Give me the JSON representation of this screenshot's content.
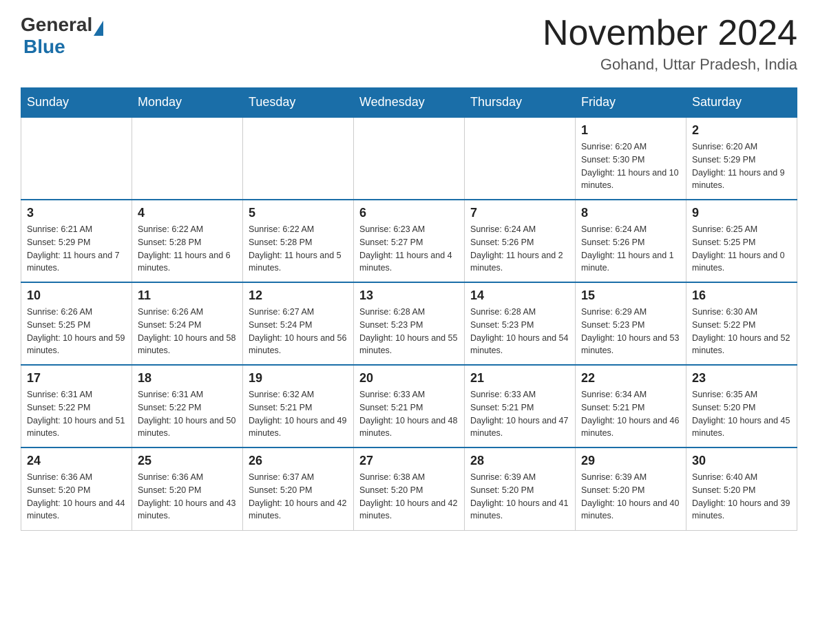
{
  "header": {
    "logo": {
      "general": "General",
      "blue": "Blue"
    },
    "title": "November 2024",
    "location": "Gohand, Uttar Pradesh, India"
  },
  "days_of_week": [
    "Sunday",
    "Monday",
    "Tuesday",
    "Wednesday",
    "Thursday",
    "Friday",
    "Saturday"
  ],
  "weeks": [
    [
      {
        "day": "",
        "info": ""
      },
      {
        "day": "",
        "info": ""
      },
      {
        "day": "",
        "info": ""
      },
      {
        "day": "",
        "info": ""
      },
      {
        "day": "",
        "info": ""
      },
      {
        "day": "1",
        "info": "Sunrise: 6:20 AM\nSunset: 5:30 PM\nDaylight: 11 hours and 10 minutes."
      },
      {
        "day": "2",
        "info": "Sunrise: 6:20 AM\nSunset: 5:29 PM\nDaylight: 11 hours and 9 minutes."
      }
    ],
    [
      {
        "day": "3",
        "info": "Sunrise: 6:21 AM\nSunset: 5:29 PM\nDaylight: 11 hours and 7 minutes."
      },
      {
        "day": "4",
        "info": "Sunrise: 6:22 AM\nSunset: 5:28 PM\nDaylight: 11 hours and 6 minutes."
      },
      {
        "day": "5",
        "info": "Sunrise: 6:22 AM\nSunset: 5:28 PM\nDaylight: 11 hours and 5 minutes."
      },
      {
        "day": "6",
        "info": "Sunrise: 6:23 AM\nSunset: 5:27 PM\nDaylight: 11 hours and 4 minutes."
      },
      {
        "day": "7",
        "info": "Sunrise: 6:24 AM\nSunset: 5:26 PM\nDaylight: 11 hours and 2 minutes."
      },
      {
        "day": "8",
        "info": "Sunrise: 6:24 AM\nSunset: 5:26 PM\nDaylight: 11 hours and 1 minute."
      },
      {
        "day": "9",
        "info": "Sunrise: 6:25 AM\nSunset: 5:25 PM\nDaylight: 11 hours and 0 minutes."
      }
    ],
    [
      {
        "day": "10",
        "info": "Sunrise: 6:26 AM\nSunset: 5:25 PM\nDaylight: 10 hours and 59 minutes."
      },
      {
        "day": "11",
        "info": "Sunrise: 6:26 AM\nSunset: 5:24 PM\nDaylight: 10 hours and 58 minutes."
      },
      {
        "day": "12",
        "info": "Sunrise: 6:27 AM\nSunset: 5:24 PM\nDaylight: 10 hours and 56 minutes."
      },
      {
        "day": "13",
        "info": "Sunrise: 6:28 AM\nSunset: 5:23 PM\nDaylight: 10 hours and 55 minutes."
      },
      {
        "day": "14",
        "info": "Sunrise: 6:28 AM\nSunset: 5:23 PM\nDaylight: 10 hours and 54 minutes."
      },
      {
        "day": "15",
        "info": "Sunrise: 6:29 AM\nSunset: 5:23 PM\nDaylight: 10 hours and 53 minutes."
      },
      {
        "day": "16",
        "info": "Sunrise: 6:30 AM\nSunset: 5:22 PM\nDaylight: 10 hours and 52 minutes."
      }
    ],
    [
      {
        "day": "17",
        "info": "Sunrise: 6:31 AM\nSunset: 5:22 PM\nDaylight: 10 hours and 51 minutes."
      },
      {
        "day": "18",
        "info": "Sunrise: 6:31 AM\nSunset: 5:22 PM\nDaylight: 10 hours and 50 minutes."
      },
      {
        "day": "19",
        "info": "Sunrise: 6:32 AM\nSunset: 5:21 PM\nDaylight: 10 hours and 49 minutes."
      },
      {
        "day": "20",
        "info": "Sunrise: 6:33 AM\nSunset: 5:21 PM\nDaylight: 10 hours and 48 minutes."
      },
      {
        "day": "21",
        "info": "Sunrise: 6:33 AM\nSunset: 5:21 PM\nDaylight: 10 hours and 47 minutes."
      },
      {
        "day": "22",
        "info": "Sunrise: 6:34 AM\nSunset: 5:21 PM\nDaylight: 10 hours and 46 minutes."
      },
      {
        "day": "23",
        "info": "Sunrise: 6:35 AM\nSunset: 5:20 PM\nDaylight: 10 hours and 45 minutes."
      }
    ],
    [
      {
        "day": "24",
        "info": "Sunrise: 6:36 AM\nSunset: 5:20 PM\nDaylight: 10 hours and 44 minutes."
      },
      {
        "day": "25",
        "info": "Sunrise: 6:36 AM\nSunset: 5:20 PM\nDaylight: 10 hours and 43 minutes."
      },
      {
        "day": "26",
        "info": "Sunrise: 6:37 AM\nSunset: 5:20 PM\nDaylight: 10 hours and 42 minutes."
      },
      {
        "day": "27",
        "info": "Sunrise: 6:38 AM\nSunset: 5:20 PM\nDaylight: 10 hours and 42 minutes."
      },
      {
        "day": "28",
        "info": "Sunrise: 6:39 AM\nSunset: 5:20 PM\nDaylight: 10 hours and 41 minutes."
      },
      {
        "day": "29",
        "info": "Sunrise: 6:39 AM\nSunset: 5:20 PM\nDaylight: 10 hours and 40 minutes."
      },
      {
        "day": "30",
        "info": "Sunrise: 6:40 AM\nSunset: 5:20 PM\nDaylight: 10 hours and 39 minutes."
      }
    ]
  ]
}
